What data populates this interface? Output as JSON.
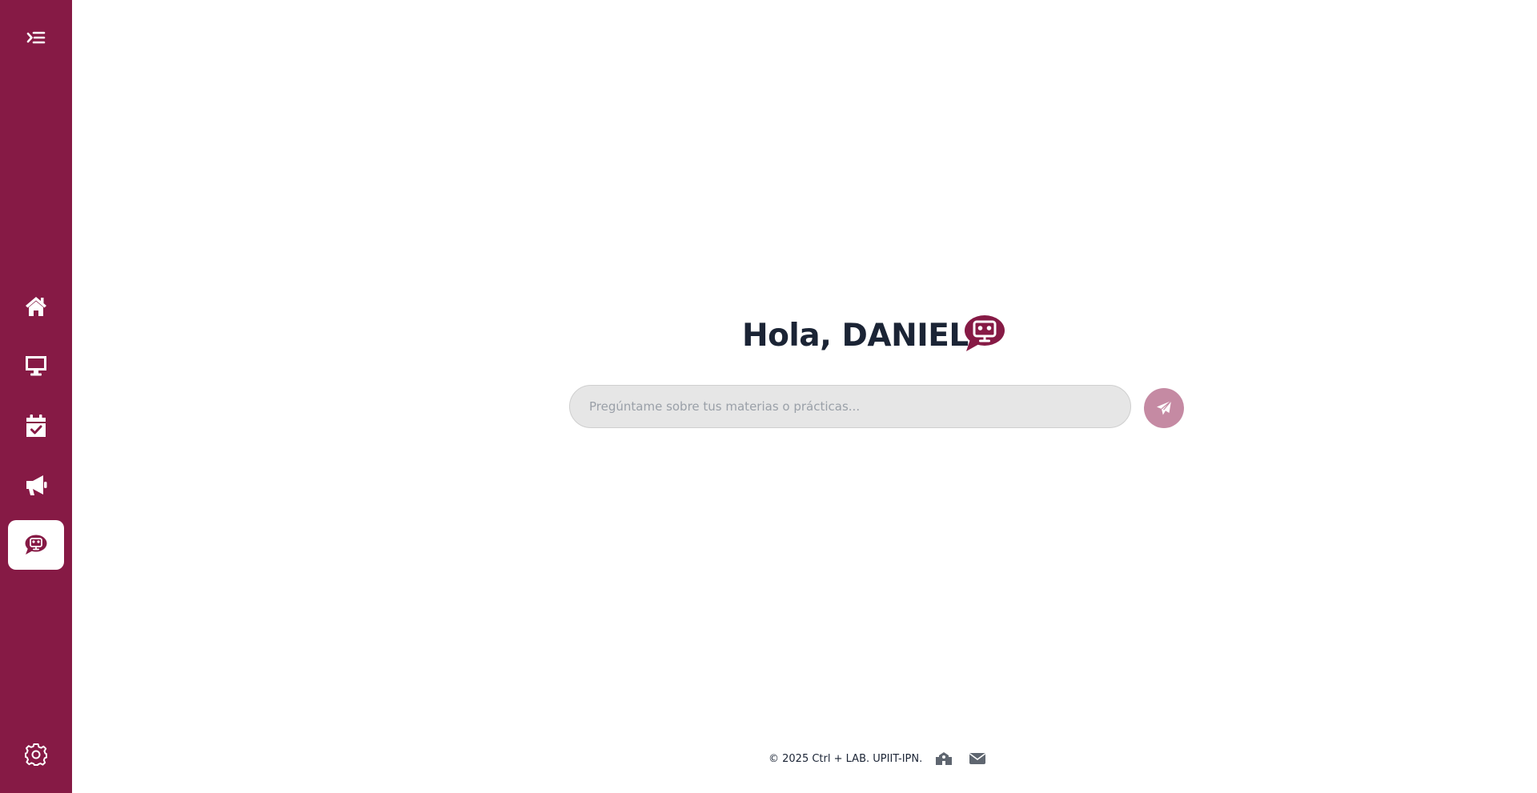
{
  "sidebar": {
    "items": [
      {
        "name": "home",
        "icon": "home-icon"
      },
      {
        "name": "desktop",
        "icon": "desktop-icon"
      },
      {
        "name": "calendar",
        "icon": "calendar-check-icon"
      },
      {
        "name": "announcements",
        "icon": "megaphone-icon"
      },
      {
        "name": "chatbot",
        "icon": "chat-bot-icon",
        "active": true
      }
    ],
    "toggle_icon": "menu-indent-icon",
    "settings_icon": "gear-icon"
  },
  "main": {
    "greeting": "Hola, DANIEL",
    "greeting_icon": "chat-bot-icon",
    "input": {
      "value": "",
      "placeholder": "Pregúntame sobre tus materias o prácticas..."
    },
    "send_icon": "paper-plane-icon"
  },
  "footer": {
    "text": "© 2025 Ctrl + LAB. UPIIT-IPN.",
    "icons": [
      "school-icon",
      "envelope-icon"
    ]
  },
  "colors": {
    "brand": "#861a45",
    "send_button": "#c58aa3",
    "input_bg": "#e6e6e6",
    "text_dark": "#1b2435",
    "footer_icon": "#5f6670"
  }
}
